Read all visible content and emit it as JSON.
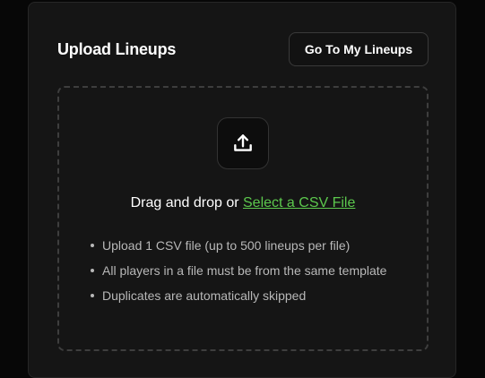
{
  "card": {
    "title": "Upload Lineups",
    "goto_button_label": "Go To My Lineups"
  },
  "dropzone": {
    "icon": "upload-icon",
    "drag_text": "Drag and drop or ",
    "select_link_label": "Select a CSV File",
    "bullets": [
      "Upload 1 CSV file (up to 500 lineups per file)",
      "All players in a file must be from the same template",
      "Duplicates are automatically skipped"
    ]
  },
  "colors": {
    "background": "#070707",
    "card": "#151515",
    "link": "#5cc84d",
    "text": "#ffffff",
    "muted_text": "#b8b8b8"
  }
}
